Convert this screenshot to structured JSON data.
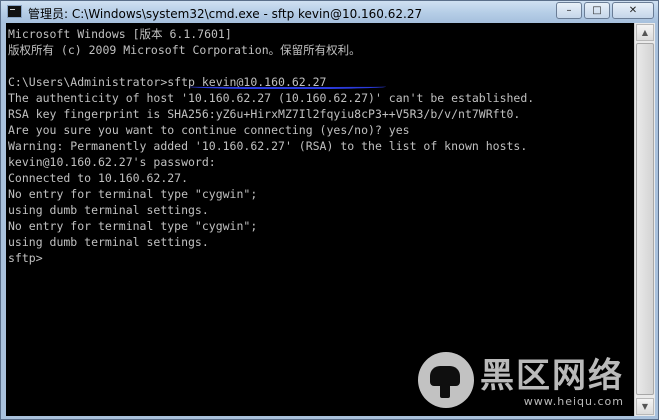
{
  "window": {
    "title": "管理员: C:\\Windows\\system32\\cmd.exe - sftp  kevin@10.160.62.27",
    "icon": "cmd-icon",
    "controls": {
      "minimize": "–",
      "maximize": "□",
      "close": "✕"
    }
  },
  "terminal": {
    "lines": [
      "Microsoft Windows [版本 6.1.7601]",
      "版权所有 (c) 2009 Microsoft Corporation。保留所有权利。",
      "",
      "C:\\Users\\Administrator>sftp kevin@10.160.62.27",
      "The authenticity of host '10.160.62.27 (10.160.62.27)' can't be established.",
      "RSA key fingerprint is SHA256:yZ6u+HirxMZ7Il2fqyiu8cP3++V5R3/b/v/nt7WRft0.",
      "Are you sure you want to continue connecting (yes/no)? yes",
      "Warning: Permanently added '10.160.62.27' (RSA) to the list of known hosts.",
      "kevin@10.160.62.27's password:",
      "Connected to 10.160.62.27.",
      "No entry for terminal type \"cygwin\";",
      "using dumb terminal settings.",
      "No entry for terminal type \"cygwin\";",
      "using dumb terminal settings.",
      "sftp>"
    ]
  },
  "watermark": {
    "name": "黑区网络",
    "url": "www.heiqu.com"
  },
  "colors": {
    "terminal_bg": "#000000",
    "terminal_fg": "#c0c0c0",
    "annotation": "#2b3bdc"
  }
}
